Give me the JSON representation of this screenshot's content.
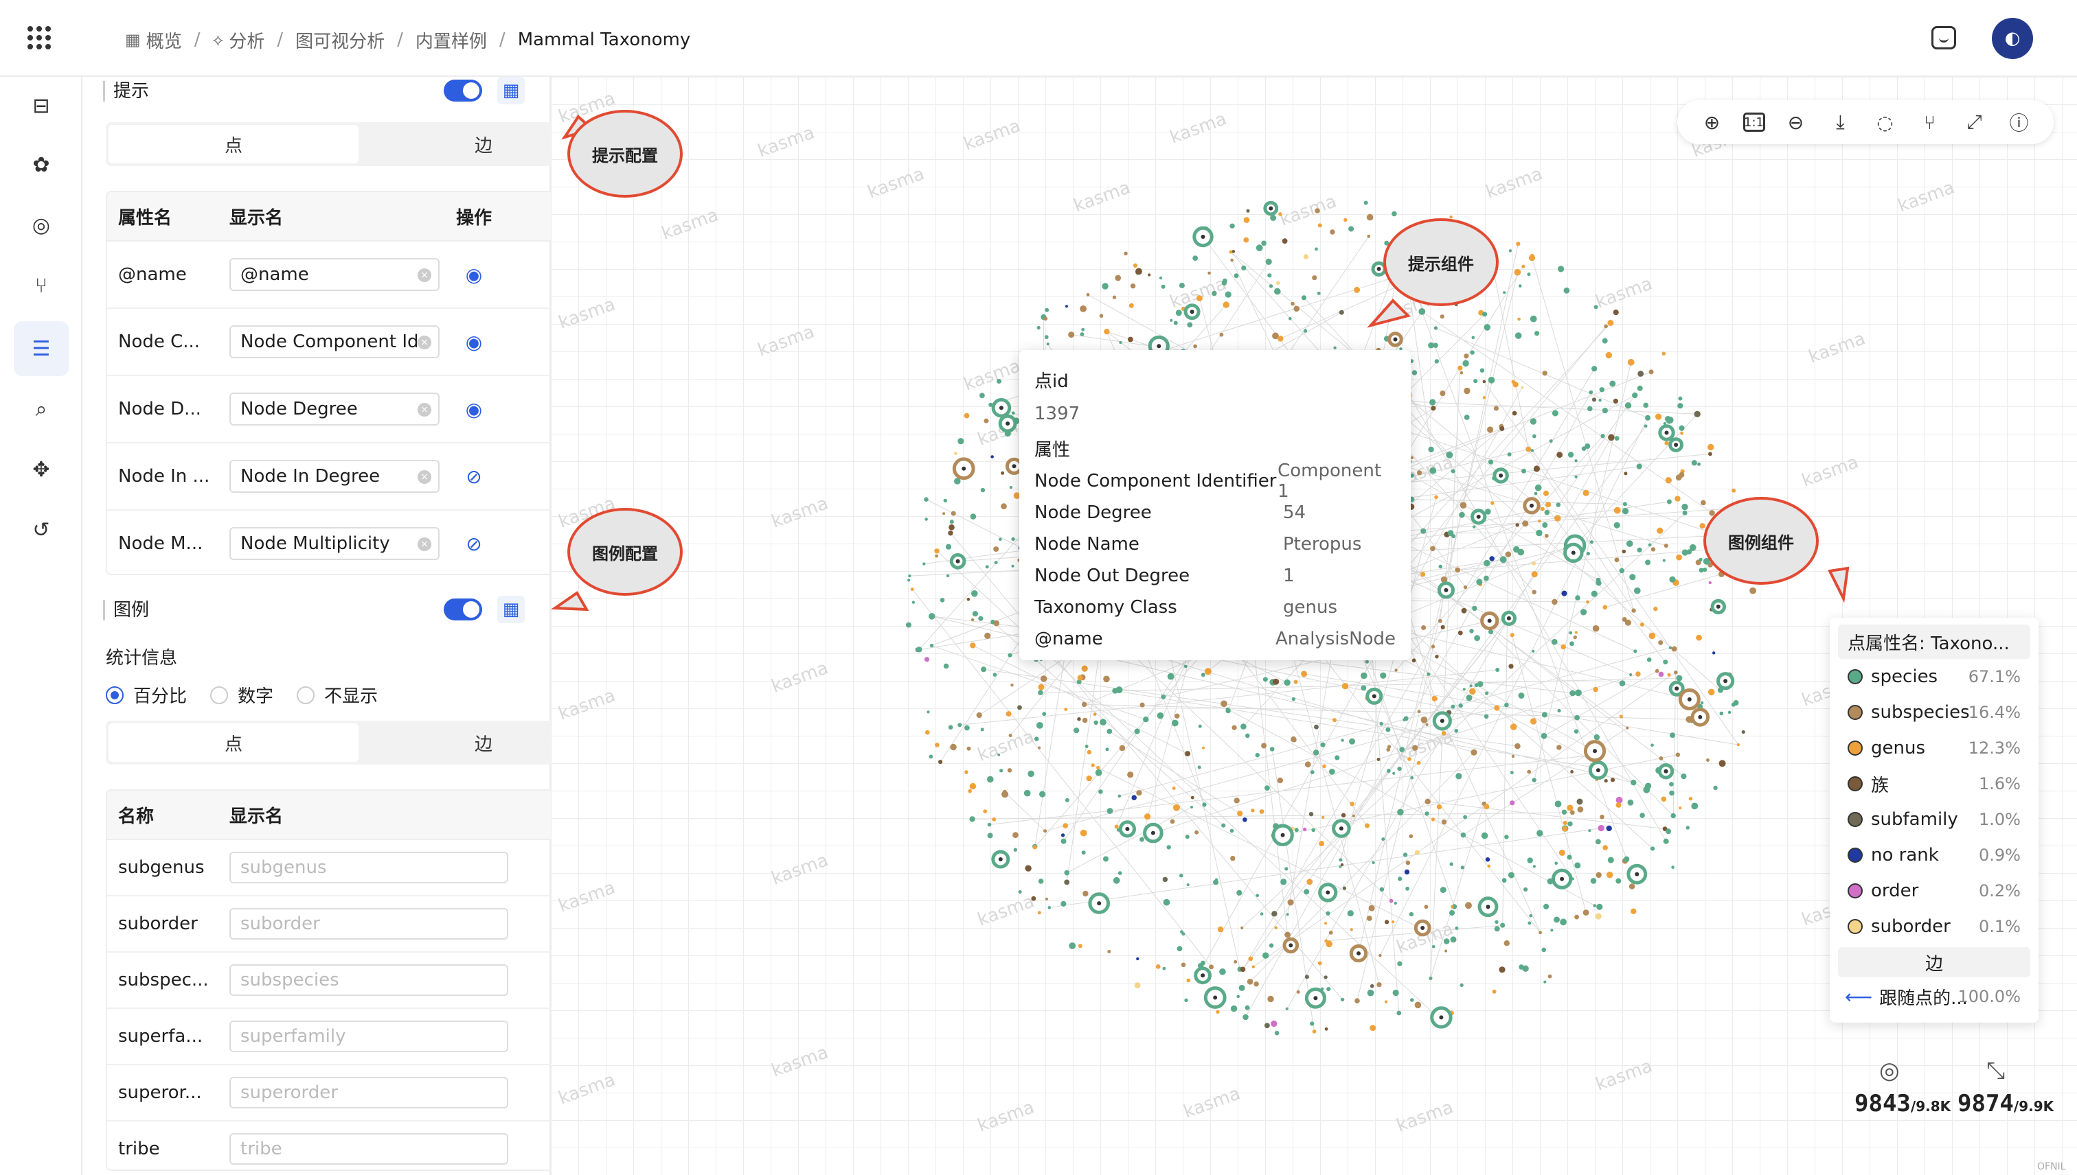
{
  "header": {
    "breadcrumb": [
      {
        "icon": "grid-icon",
        "label": "概览"
      },
      {
        "icon": "analysis-icon",
        "label": "分析"
      },
      {
        "icon": "",
        "label": "图可视分析"
      },
      {
        "icon": "",
        "label": "内置样例"
      },
      {
        "icon": "",
        "label": "Mammal Taxonomy"
      }
    ],
    "separator": "/"
  },
  "tip_section": {
    "title": "提示",
    "tabs": [
      "点",
      "边"
    ],
    "table": {
      "headers": [
        "属性名",
        "显示名",
        "操作"
      ],
      "rows": [
        {
          "attr": "@name",
          "display": "@name",
          "visible": true
        },
        {
          "attr": "Node C...",
          "display": "Node Component Id",
          "visible": true
        },
        {
          "attr": "Node D...",
          "display": "Node Degree",
          "visible": true
        },
        {
          "attr": "Node In ...",
          "display": "Node In Degree",
          "visible": false
        },
        {
          "attr": "Node M...",
          "display": "Node Multiplicity",
          "visible": false
        }
      ]
    }
  },
  "legend_section": {
    "title": "图例",
    "stats_label": "统计信息",
    "stats_options": [
      {
        "label": "百分比",
        "selected": true
      },
      {
        "label": "数字",
        "selected": false
      },
      {
        "label": "不显示",
        "selected": false
      }
    ],
    "tabs": [
      "点",
      "边"
    ],
    "table": {
      "headers": [
        "名称",
        "显示名"
      ],
      "rows": [
        {
          "name": "subgenus",
          "placeholder": "subgenus"
        },
        {
          "name": "suborder",
          "placeholder": "suborder"
        },
        {
          "name": "subspec...",
          "placeholder": "subspecies"
        },
        {
          "name": "superfa...",
          "placeholder": "superfamily"
        },
        {
          "name": "superor...",
          "placeholder": "superorder"
        },
        {
          "name": "tribe",
          "placeholder": "tribe"
        }
      ]
    }
  },
  "canvas": {
    "watermark": "kasma",
    "toolbar": [
      "zoom-in-icon",
      "one-to-one-icon",
      "zoom-out-icon",
      "download-icon",
      "lasso-icon",
      "path-icon",
      "fullscreen-icon",
      "help-icon"
    ],
    "tooltip": {
      "id_label": "点id",
      "id_value": "1397",
      "attr_label": "属性",
      "attributes": [
        {
          "key": "Node Component Identifier",
          "value": "Component 1"
        },
        {
          "key": "Node Degree",
          "value": "54"
        },
        {
          "key": "Node Name",
          "value": "Pteropus"
        },
        {
          "key": "Node Out Degree",
          "value": "1"
        },
        {
          "key": "Taxonomy Class",
          "value": "genus"
        },
        {
          "key": "@name",
          "value": "AnalysisNode"
        }
      ]
    },
    "callouts": {
      "tip_config": "提示配置",
      "legend_config": "图例配置",
      "tip_component": "提示组件",
      "legend_component": "图例组件"
    },
    "legend": {
      "node_header": "点属性名: Taxono...",
      "items": [
        {
          "label": "species",
          "pct": "67.1%",
          "color": "#5aaa8a"
        },
        {
          "label": "subspecies",
          "pct": "16.4%",
          "color": "#b38b5a"
        },
        {
          "label": "genus",
          "pct": "12.3%",
          "color": "#f0a23a"
        },
        {
          "label": "族",
          "pct": "1.6%",
          "color": "#7a5a38"
        },
        {
          "label": "subfamily",
          "pct": "1.0%",
          "color": "#6f6a55"
        },
        {
          "label": "no rank",
          "pct": "0.9%",
          "color": "#1f3aa0"
        },
        {
          "label": "order",
          "pct": "0.2%",
          "color": "#d06fc8"
        },
        {
          "label": "suborder",
          "pct": "0.1%",
          "color": "#f5d58a"
        }
      ],
      "edge_header": "边",
      "edge_item": {
        "label": "跟随点的...",
        "pct": "100.0%"
      }
    },
    "counters": {
      "nodes_shown": "9843",
      "nodes_total": "/9.8K",
      "edges_shown": "9874",
      "edges_total": "/9.9K"
    },
    "corner_tag": "OFNIL"
  }
}
